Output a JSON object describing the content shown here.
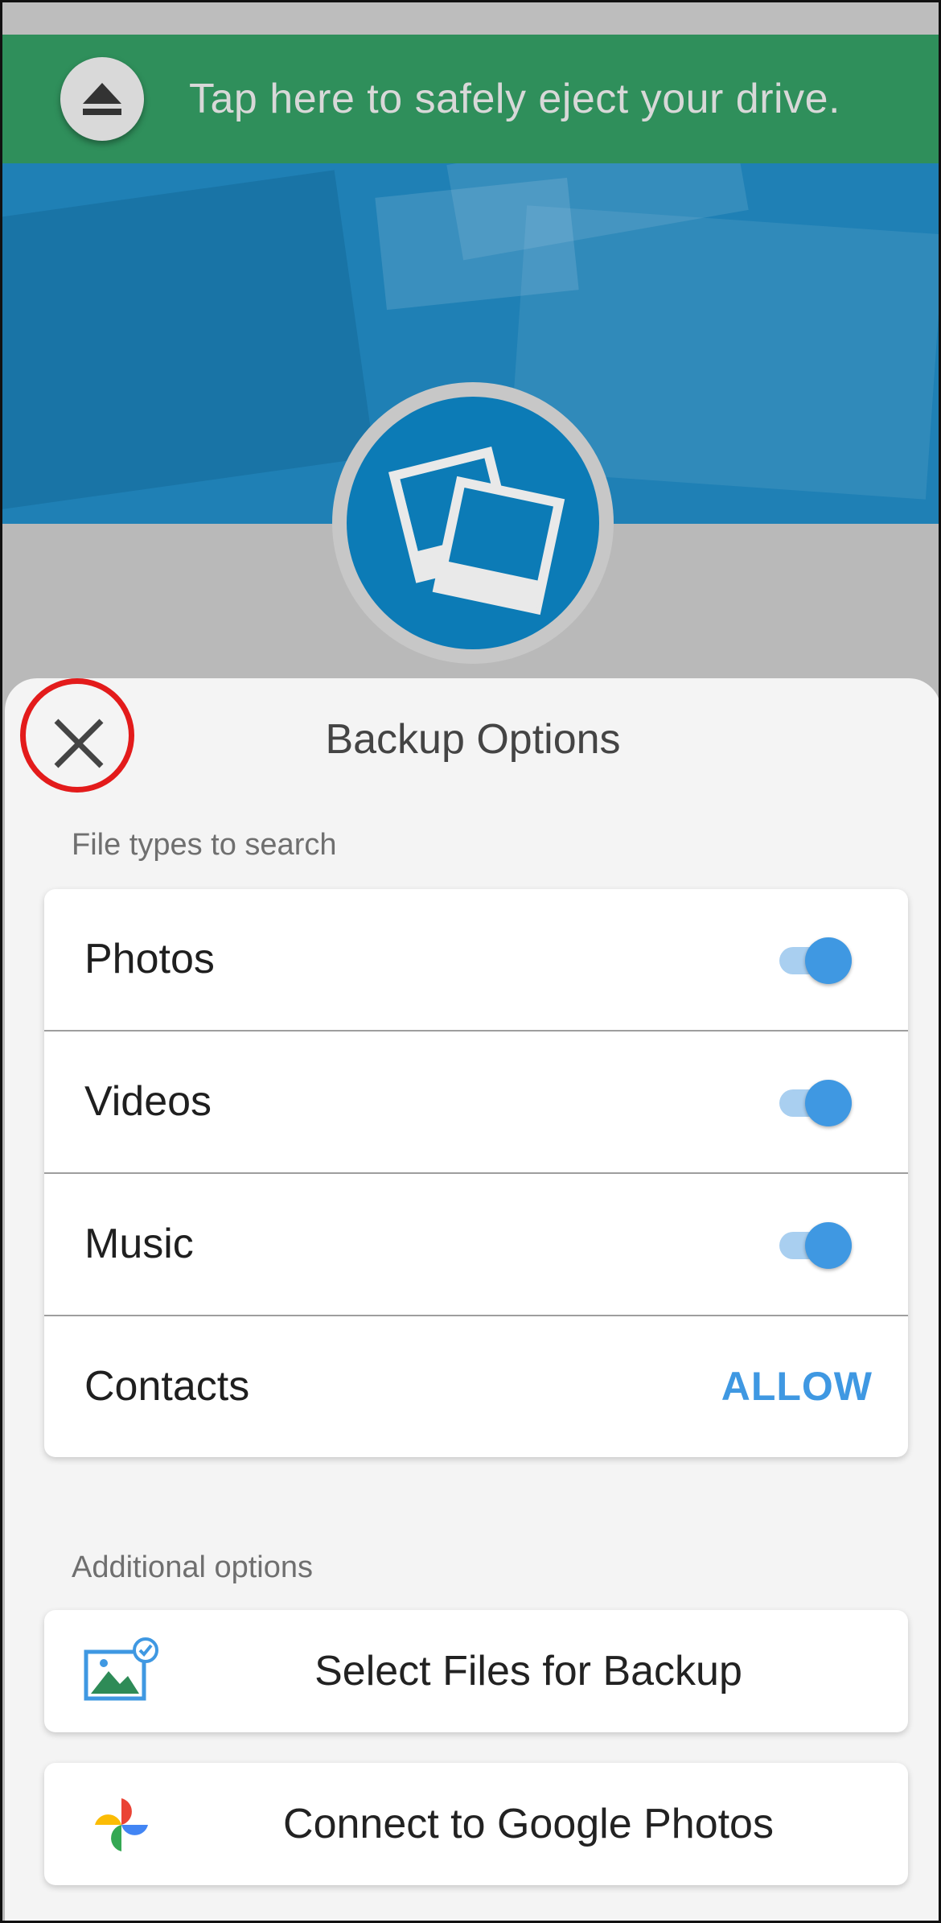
{
  "eject_banner": {
    "text": "Tap here to safely eject your drive.",
    "icon": "eject-icon"
  },
  "sheet": {
    "title": "Backup Options",
    "close_icon": "close-icon"
  },
  "file_types": {
    "section_label": "File types to search",
    "rows": [
      {
        "label": "Photos",
        "enabled": true
      },
      {
        "label": "Videos",
        "enabled": true
      },
      {
        "label": "Music",
        "enabled": true
      },
      {
        "label": "Contacts",
        "action": "ALLOW"
      }
    ]
  },
  "additional": {
    "section_label": "Additional options",
    "actions": [
      {
        "label": "Select Files for Backup",
        "icon": "image-check-icon"
      },
      {
        "label": "Connect to Google Photos",
        "icon": "google-photos-icon"
      }
    ]
  },
  "colors": {
    "banner": "#2f8f5b",
    "hero": "#1f80b5",
    "accent": "#3f98e2",
    "highlight_ring": "#e31b1b"
  }
}
